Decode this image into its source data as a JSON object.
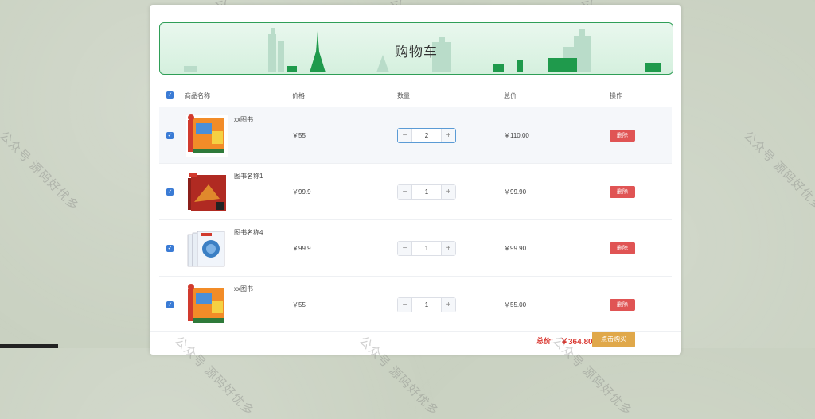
{
  "banner": {
    "title": "购物车"
  },
  "table": {
    "headers": {
      "name": "商品名称",
      "price": "价格",
      "qty": "数量",
      "total": "总价",
      "action": "操作"
    },
    "rows": [
      {
        "name": "xx图书",
        "price": "￥55",
        "qty": "2",
        "total": "￥110.00",
        "delete": "删除"
      },
      {
        "name": "图书名称1",
        "price": "￥99.9",
        "qty": "1",
        "total": "￥99.90",
        "delete": "删除"
      },
      {
        "name": "图书名称4",
        "price": "￥99.9",
        "qty": "1",
        "total": "￥99.90",
        "delete": "删除"
      },
      {
        "name": "xx图书",
        "price": "￥55",
        "qty": "1",
        "total": "￥55.00",
        "delete": "删除"
      }
    ]
  },
  "footer": {
    "sum_label": "总价:",
    "sum_value": "￥364.80",
    "buy_label": "点击购买"
  },
  "stepper": {
    "minus": "−",
    "plus": "+"
  },
  "checkbox": {
    "mark": "✓"
  },
  "watermark": "公众号 源码好优多",
  "colors": {
    "accent": "#3a7bd5",
    "delete": "#e05454",
    "buy": "#e0a84a",
    "sum": "#d9362f",
    "banner_border": "#2f9e57"
  }
}
